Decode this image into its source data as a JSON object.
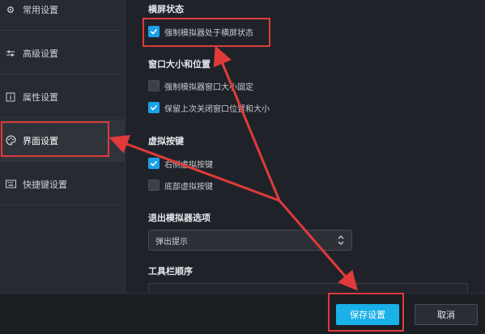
{
  "sidebar": {
    "items": [
      {
        "label": "常用设置",
        "icon": "gear-icon"
      },
      {
        "label": "高级设置",
        "icon": "sliders-icon"
      },
      {
        "label": "属性设置",
        "icon": "info-icon"
      },
      {
        "label": "界面设置",
        "icon": "palette-icon"
      },
      {
        "label": "快捷键设置",
        "icon": "keyboard-icon"
      }
    ]
  },
  "main": {
    "landscape": {
      "title": "横屏状态",
      "options": [
        {
          "label": "强制模拟器处于横屏状态",
          "checked": true
        }
      ]
    },
    "window": {
      "title": "窗口大小和位置",
      "options": [
        {
          "label": "强制模拟器窗口大小固定",
          "checked": false
        },
        {
          "label": "保留上次关闭窗口位置和大小",
          "checked": true
        }
      ]
    },
    "virtual_keys": {
      "title": "虚拟按键",
      "options": [
        {
          "label": "右侧虚拟按键",
          "checked": true
        },
        {
          "label": "底部虚拟按键",
          "checked": false
        }
      ]
    },
    "exit": {
      "title": "退出模拟器选项",
      "selected": "弹出提示"
    },
    "toolbar_order": {
      "title": "工具栏顺序"
    }
  },
  "footer": {
    "save_label": "保存设置",
    "cancel_label": "取消"
  },
  "colors": {
    "accent": "#1ab0e8",
    "annotation": "#e03a3a"
  }
}
